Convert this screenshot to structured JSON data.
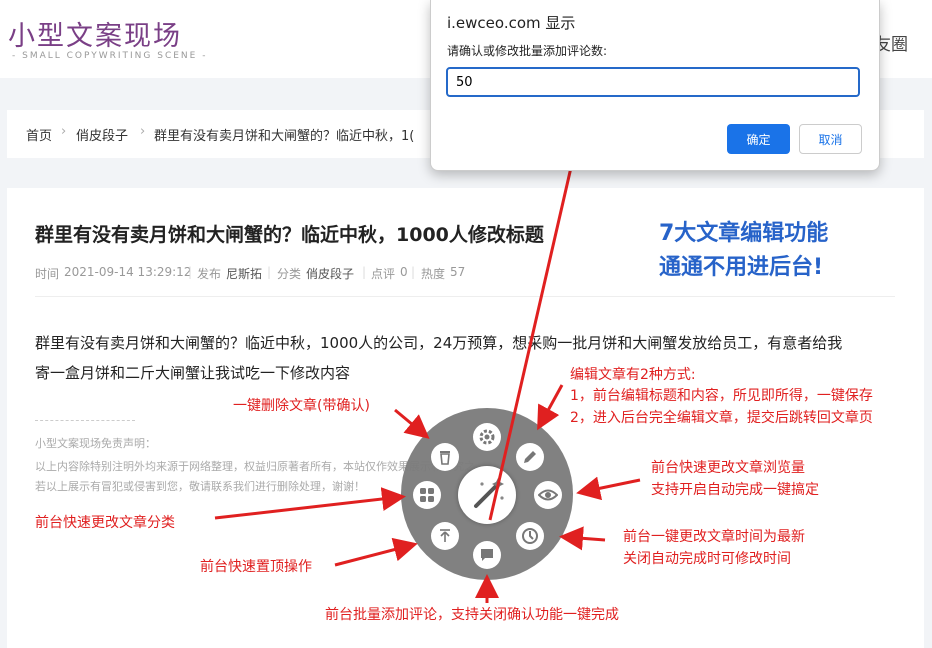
{
  "header": {
    "logo_title": "小型文案现场",
    "logo_subtitle": "- SMALL COPYWRITING SCENE -",
    "nav_fragment": "友圈"
  },
  "breadcrumb": {
    "home": "首页",
    "category": "俏皮段子",
    "current": "群里有没有卖月饼和大闸蟹的？临近中秋，1("
  },
  "article": {
    "title": "群里有没有卖月饼和大闸蟹的？临近中秋，1000人修改标题",
    "meta": {
      "time_label": "时间",
      "time_value": "2021-09-14 13:29:12",
      "publish_label": "发布",
      "author": "尼斯拓",
      "category_label": "分类",
      "category": "俏皮段子",
      "comment_label": "点评",
      "comments": "0",
      "heat_label": "热度",
      "heat": "57"
    },
    "body_line1": "群里有没有卖月饼和大闸蟹的？临近中秋，1000人的公司，24万预算，想采购一批月饼和大闸蟹发放给员工，有意者给我",
    "body_line2": "寄一盒月饼和二斤大闸蟹让我试吃一下修改内容",
    "disclaimer_title": "小型文案现场免责声明：",
    "disclaimer_line1": "以上内容除特别注明外均来源于网络整理，权益归原著者所有，本站仅作效果展示和研究之",
    "disclaimer_line2": "若以上展示有冒犯或侵害到您，敬请联系我们进行删除处理，谢谢！"
  },
  "dialog": {
    "title": "i.ewceo.com 显示",
    "message": "请确认或修改批量添加评论数:",
    "input_value": "50",
    "ok_label": "确定",
    "cancel_label": "取消"
  },
  "promo": {
    "line1": "7大文章编辑功能",
    "line2": "通通不用进后台!"
  },
  "annotations": {
    "edit_title": "编辑文章有2种方式:",
    "edit_1": "1，前台编辑标题和内容，所见即所得，一键保存",
    "edit_2": "2，进入后台完全编辑文章，提交后跳转回文章页",
    "delete": "一键删除文章(带确认)",
    "views_1": "前台快速更改文章浏览量",
    "views_2": "支持开启自动完成一键搞定",
    "category": "前台快速更改文章分类",
    "time_1": "前台一键更改文章时间为最新",
    "time_2": "关闭自动完成时可修改时间",
    "sticky": "前台快速置顶操作",
    "comments": "前台批量添加评论，支持关闭确认功能一键完成"
  },
  "colors": {
    "annotation_red": "#e02020",
    "promo_blue": "#2763c9",
    "logo_purple": "#7a3f86",
    "button_blue": "#1a73e8"
  },
  "menu_icons": [
    "magic-wand-icon",
    "gear-icon",
    "pencil-icon",
    "eye-icon",
    "clock-icon",
    "comment-icon",
    "pin-top-icon",
    "grid-icon",
    "trash-icon"
  ]
}
